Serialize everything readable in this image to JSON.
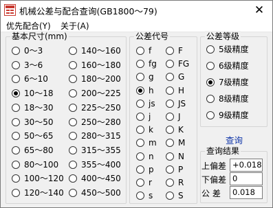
{
  "window": {
    "title": "机械公差与配合查询(GB1800～79)",
    "close_glyph": "✕"
  },
  "menu": [
    "优先配合(Y)",
    "关于(A)"
  ],
  "size_group": {
    "title": "基本尺寸(mm)",
    "left_options": [
      "0～3",
      "3～6",
      "6～10",
      "10～18",
      "18～30",
      "30～50",
      "50～65",
      "65～80",
      "80～100",
      "100～120",
      "120～140"
    ],
    "right_options": [
      "140～160",
      "160～180",
      "180～200",
      "200～225",
      "225～250",
      "250～280",
      "280～315",
      "315～355",
      "355～400",
      "400～450",
      "450～500"
    ],
    "selected": "10～18"
  },
  "code_group": {
    "title": "公差代号",
    "left_options": [
      "f",
      "fg",
      "g",
      "h",
      "js",
      "j",
      "k",
      "m",
      "n",
      "p",
      "r",
      "s"
    ],
    "right_options": [
      "F",
      "FG",
      "G",
      "H",
      "JS",
      "J",
      "K",
      "M",
      "N",
      "P",
      "R",
      "S"
    ],
    "selected": "h"
  },
  "grade_group": {
    "title": "公差等级",
    "options": [
      "5级精度",
      "6级精度",
      "7级精度",
      "8级精度",
      "9级精度"
    ],
    "selected": "7级精度"
  },
  "query_label": "查询",
  "result_group": {
    "title": "查询结果",
    "upper_label": "上偏差",
    "upper_value": "+0.018",
    "lower_label": "下偏差",
    "lower_value": "0",
    "tolerance_label": "公 差",
    "tolerance_value": "0.018"
  },
  "colors": {
    "link": "#0f35a8",
    "icon_red": "#c8372d"
  }
}
